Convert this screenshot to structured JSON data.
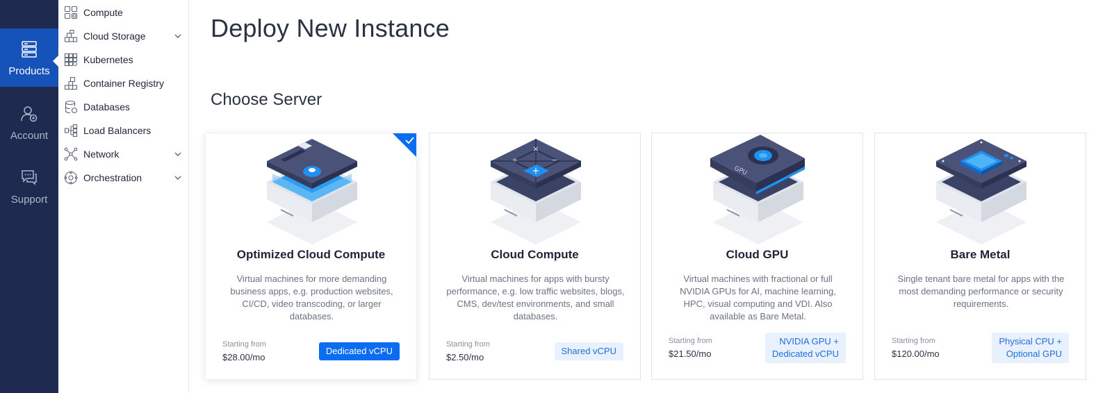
{
  "rail": {
    "items": [
      {
        "label": "Products",
        "icon": "server-stack-icon"
      },
      {
        "label": "Account",
        "icon": "user-icon"
      },
      {
        "label": "Support",
        "icon": "chat-icon"
      }
    ]
  },
  "subnav": {
    "items": [
      {
        "label": "Compute",
        "icon": "compute-icon"
      },
      {
        "label": "Cloud Storage",
        "icon": "storage-icon"
      },
      {
        "label": "Kubernetes",
        "icon": "kubernetes-icon"
      },
      {
        "label": "Container Registry",
        "icon": "registry-icon"
      },
      {
        "label": "Databases",
        "icon": "database-icon"
      },
      {
        "label": "Load Balancers",
        "icon": "load-balancer-icon"
      },
      {
        "label": "Network",
        "icon": "network-icon"
      },
      {
        "label": "Orchestration",
        "icon": "orchestration-icon"
      }
    ]
  },
  "main": {
    "title": "Deploy New Instance",
    "section_title": "Choose Server",
    "cards": [
      {
        "title": "Optimized Cloud Compute",
        "description": "Virtual machines for more demanding business apps, e.g. production websites, CI/CD, video transcoding, or larger databases.",
        "from_label": "Starting from",
        "price": "$28.00/mo",
        "badge": "Dedicated vCPU",
        "selected": true
      },
      {
        "title": "Cloud Compute",
        "description": "Virtual machines for apps with bursty performance, e.g. low traffic websites, blogs, CMS, dev/test environments, and small databases.",
        "from_label": "Starting from",
        "price": "$2.50/mo",
        "badge": "Shared vCPU",
        "selected": false
      },
      {
        "title": "Cloud GPU",
        "description": "Virtual machines with fractional or full NVIDIA GPUs for AI, machine learning, HPC, visual computing and VDI. Also available as Bare Metal.",
        "from_label": "Starting from",
        "price": "$21.50/mo",
        "badge_line1": "NVIDIA GPU +",
        "badge_line2": "Dedicated vCPU",
        "gpu_label": "GPU",
        "selected": false
      },
      {
        "title": "Bare Metal",
        "description": "Single tenant bare metal for apps with the most demanding performance or security requirements.",
        "from_label": "Starting from",
        "price": "$120.00/mo",
        "badge_line1": "Physical CPU +",
        "badge_line2": "Optional GPU",
        "selected": false
      }
    ]
  },
  "colors": {
    "rail_bg": "#1e2a4f",
    "rail_active": "#1553b8",
    "accent": "#0a6cf0",
    "badge_bg": "#e8f1fd",
    "text_dark": "#1f2437"
  }
}
